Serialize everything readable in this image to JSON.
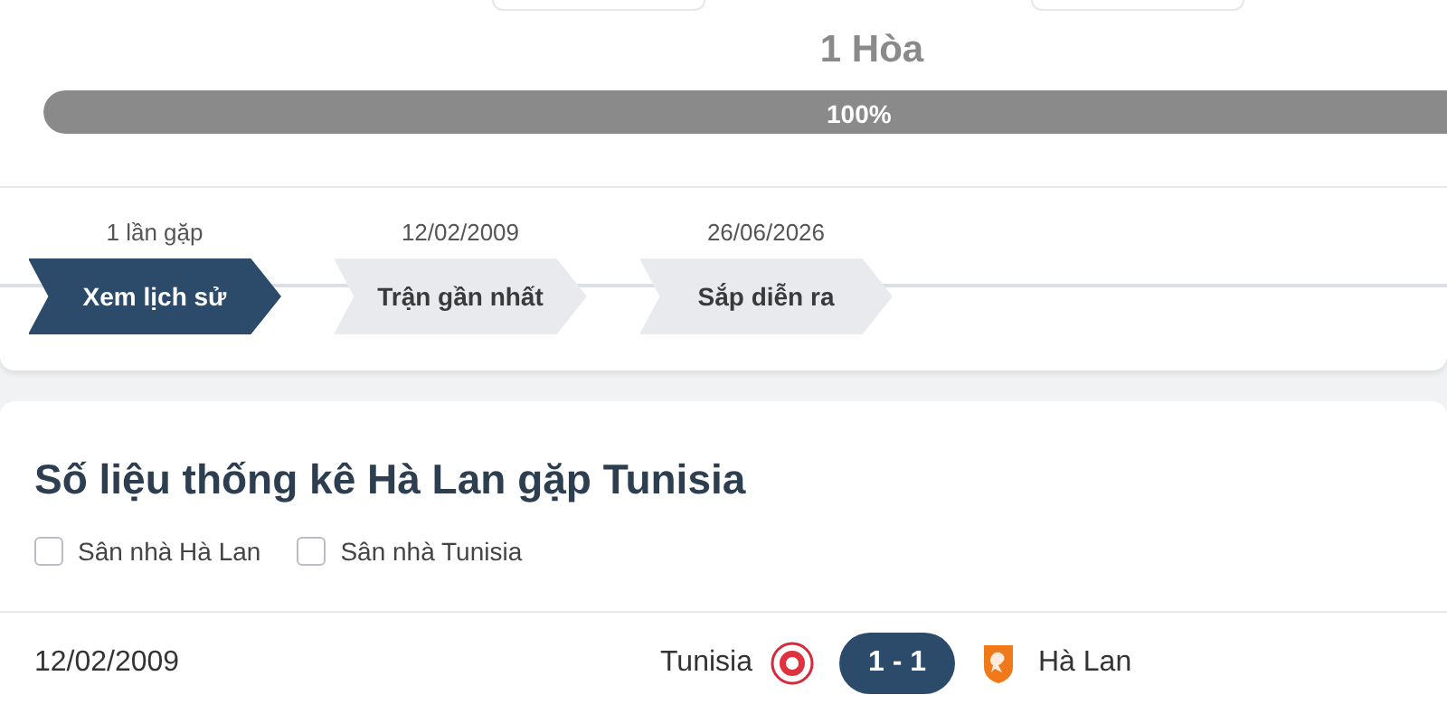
{
  "summary": {
    "draws": "1 Hòa",
    "bar": {
      "level": 1,
      "reading": "100%"
    }
  },
  "timeline": {
    "steps": [
      {
        "caption": "1 lần gặp",
        "label": "Xem lịch sử",
        "selected": true
      },
      {
        "caption": "12/02/2009",
        "label": "Trận gần nhất",
        "selected": false
      },
      {
        "caption": "26/06/2026",
        "label": "Sắp diễn ra",
        "selected": false
      }
    ]
  },
  "stats": {
    "title": "Số liệu thống kê Hà Lan gặp Tunisia",
    "filters": [
      {
        "label": "Sân nhà Hà Lan",
        "checked": false
      },
      {
        "label": "Sân nhà Tunisia",
        "checked": false
      }
    ],
    "matches": [
      {
        "date": "12/02/2009",
        "home": "Tunisia",
        "score": "1 - 1",
        "away": "Hà Lan"
      }
    ]
  }
}
